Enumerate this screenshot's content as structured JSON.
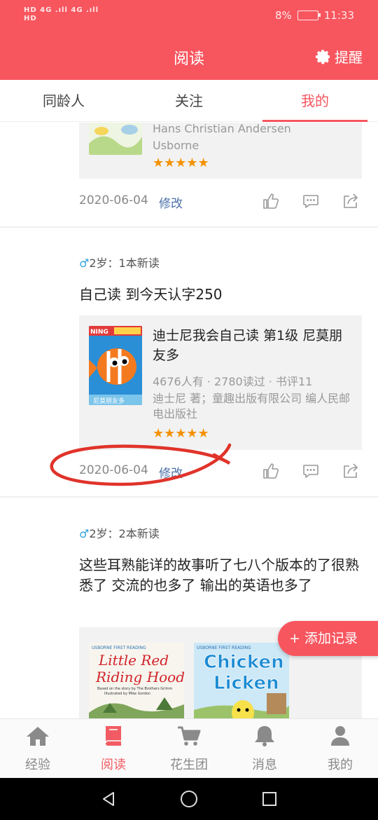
{
  "status": {
    "left_line1": "HD 4G .ıll 4G .ıll",
    "left_line2": "HD",
    "battery": "8%",
    "time": "11:33"
  },
  "header": {
    "title": "阅读",
    "remind_label": "提醒"
  },
  "tabs": [
    {
      "label": "同龄人",
      "active": false
    },
    {
      "label": "关注",
      "active": false
    },
    {
      "label": "我的",
      "active": true
    }
  ],
  "posts": [
    {
      "book": {
        "meta_line1": "Hans Christian Andersen",
        "meta_line2": "Usborne",
        "rating": "★★★★★"
      },
      "date": "2020-06-04",
      "edit_label": "修改"
    },
    {
      "gender_icon": "♂",
      "age_text": "2岁：1本新读",
      "text": "自己读  到今天认字250",
      "book": {
        "title": "迪士尼我会自己读 第1级 尼莫朋友多",
        "stats": "4676人有 · 2780读过 · 书评11",
        "publisher": "迪士尼 著；童趣出版有限公司 编人民邮电出版社",
        "rating": "★★★★★",
        "cover_label": "尼莫朋友多"
      },
      "date": "2020-06-04",
      "edit_label": "修改"
    },
    {
      "gender_icon": "♂",
      "age_text": "2岁：2本新读",
      "text": "这些耳熟能详的故事听了七八个版本的了很熟悉了  交流的也多了   输出的英语也多了",
      "books": [
        {
          "series": "USBORNE FIRST READING",
          "title": "Little Red Riding Hood",
          "credit1": "Based on the story by The Brothers Grimm",
          "credit2": "Illustrated by Mike Gordon"
        },
        {
          "series": "USBORNE FIRST READING",
          "title": "Chicken Licken"
        }
      ]
    }
  ],
  "fab_label": "+ 添加记录",
  "bottom_nav": [
    {
      "label": "经验",
      "icon": "home-icon",
      "active": false
    },
    {
      "label": "阅读",
      "icon": "book-icon",
      "active": true
    },
    {
      "label": "花生团",
      "icon": "cart-icon",
      "active": false
    },
    {
      "label": "消息",
      "icon": "bell-icon",
      "active": false
    },
    {
      "label": "我的",
      "icon": "person-icon",
      "active": false
    }
  ],
  "colors": {
    "brand": "#f7565f",
    "link": "#4a70a8",
    "star": "#f39200",
    "annotation": "#e0332a"
  }
}
